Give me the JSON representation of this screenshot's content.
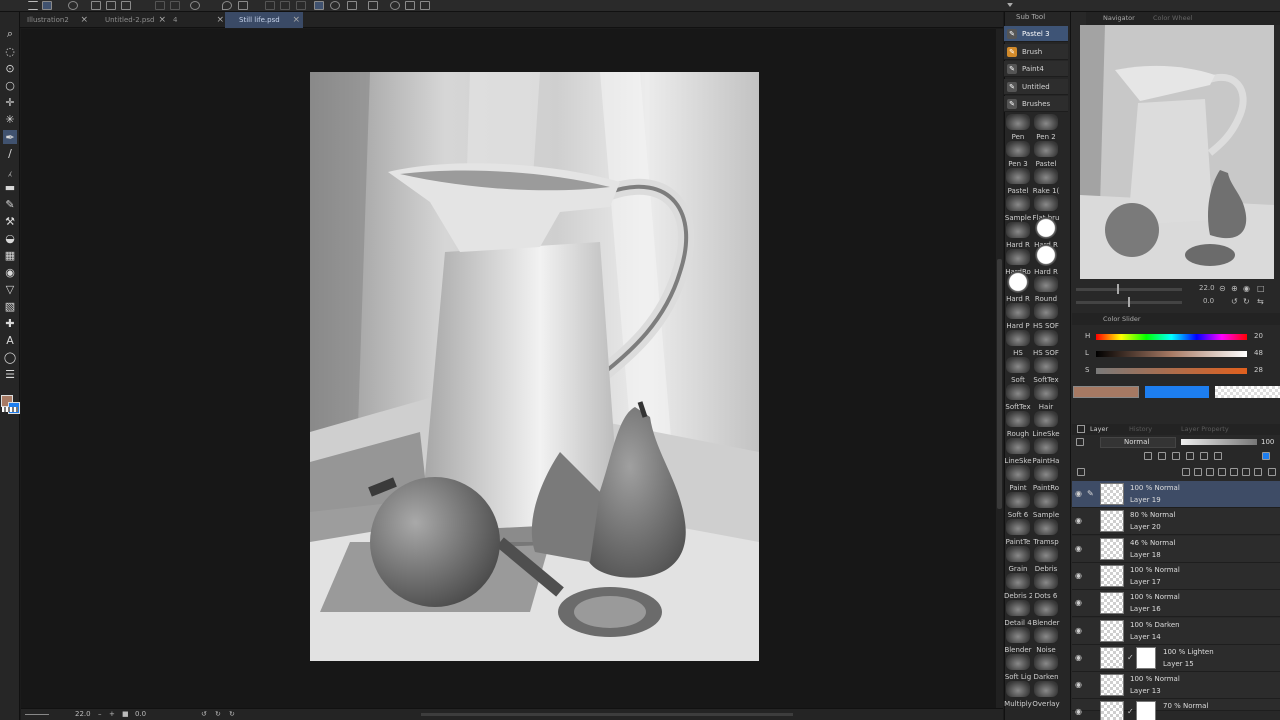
{
  "tabs": [
    {
      "label": "Illustration2",
      "active": false
    },
    {
      "label": "Untitled-2.psd",
      "active": false
    },
    {
      "label": "4",
      "active": false
    },
    {
      "label": "Still life.psd",
      "active": true
    }
  ],
  "colors": {
    "foreground": "#a77a64",
    "background": "#1d7ef0",
    "selection": "#3e5476"
  },
  "status": {
    "zoom": "22.0",
    "angle": "0.0"
  },
  "subtool": {
    "title": "Sub Tool",
    "groups": [
      {
        "label": "Pastel 3",
        "icon": "pencil-icon",
        "selected": true
      },
      {
        "label": "Brush",
        "icon": "brush-icon",
        "selected": false
      },
      {
        "label": "Paint4",
        "icon": "pencil-icon",
        "selected": false
      },
      {
        "label": "Untitled Brush",
        "icon": "pencil-icon",
        "selected": false
      },
      {
        "label": "Brushes",
        "icon": "pencil-icon",
        "selected": false
      }
    ],
    "brushes": [
      {
        "l": "Pen",
        "r": "Pen 2"
      },
      {
        "l": "Pen 3",
        "r": "Pastel"
      },
      {
        "l": "Pastel",
        "r": "Rake 1("
      },
      {
        "l": "Sample",
        "r": "Flat bru"
      },
      {
        "l": "Hard R",
        "r": "Hard R"
      },
      {
        "l": "HardRo",
        "r": "Hard R"
      },
      {
        "l": "Hard R",
        "r": "Round"
      },
      {
        "l": "Hard P",
        "r": "HS SOF"
      },
      {
        "l": "HS",
        "r": "HS SOF"
      },
      {
        "l": "Soft",
        "r": "SoftTex"
      },
      {
        "l": "SoftTex",
        "r": "Hair"
      },
      {
        "l": "Rough",
        "r": "LineSke"
      },
      {
        "l": "LineSke",
        "r": "PaintHa"
      },
      {
        "l": "Paint",
        "r": "PaintRo"
      },
      {
        "l": "Soft 6",
        "r": "Sample"
      },
      {
        "l": "PaintTe",
        "r": "Tramsp"
      },
      {
        "l": "Grain",
        "r": "Debris"
      },
      {
        "l": "Debris 2",
        "r": "Dots 6"
      },
      {
        "l": "Detail 4",
        "r": "Blender"
      },
      {
        "l": "Blender",
        "r": "Noise"
      },
      {
        "l": "Soft Lig",
        "r": "Darken"
      },
      {
        "l": "Multiply",
        "r": "Overlay"
      }
    ]
  },
  "navigator": {
    "title": "Navigator",
    "title2": "Color Wheel",
    "zoom": "22.0",
    "angle": "0.0"
  },
  "color_slider": {
    "title": "Color Slider",
    "h": {
      "label": "H",
      "value": "20"
    },
    "l": {
      "label": "L",
      "value": "48"
    },
    "s": {
      "label": "S",
      "value": "28"
    }
  },
  "layers": {
    "tabs": [
      "Layer",
      "History",
      "Layer Property"
    ],
    "blend_mode": "Normal",
    "opacity": "100",
    "items": [
      {
        "mode": "100 % Normal",
        "name": "Layer 19",
        "selected": true,
        "clip": false
      },
      {
        "mode": "80 % Normal",
        "name": "Layer 20",
        "selected": false,
        "clip": false
      },
      {
        "mode": "46 % Normal",
        "name": "Layer 18",
        "selected": false,
        "clip": false
      },
      {
        "mode": "100 % Normal",
        "name": "Layer 17",
        "selected": false,
        "clip": false
      },
      {
        "mode": "100 % Normal",
        "name": "Layer 16",
        "selected": false,
        "clip": false
      },
      {
        "mode": "100 % Darken",
        "name": "Layer 14",
        "selected": false,
        "clip": false
      },
      {
        "mode": "100 % Lighten",
        "name": "Layer 15",
        "selected": false,
        "clip": true
      },
      {
        "mode": "100 % Normal",
        "name": "Layer 13",
        "selected": false,
        "clip": false
      },
      {
        "mode": "70 % Normal",
        "name": "",
        "selected": false,
        "clip": true
      }
    ]
  }
}
